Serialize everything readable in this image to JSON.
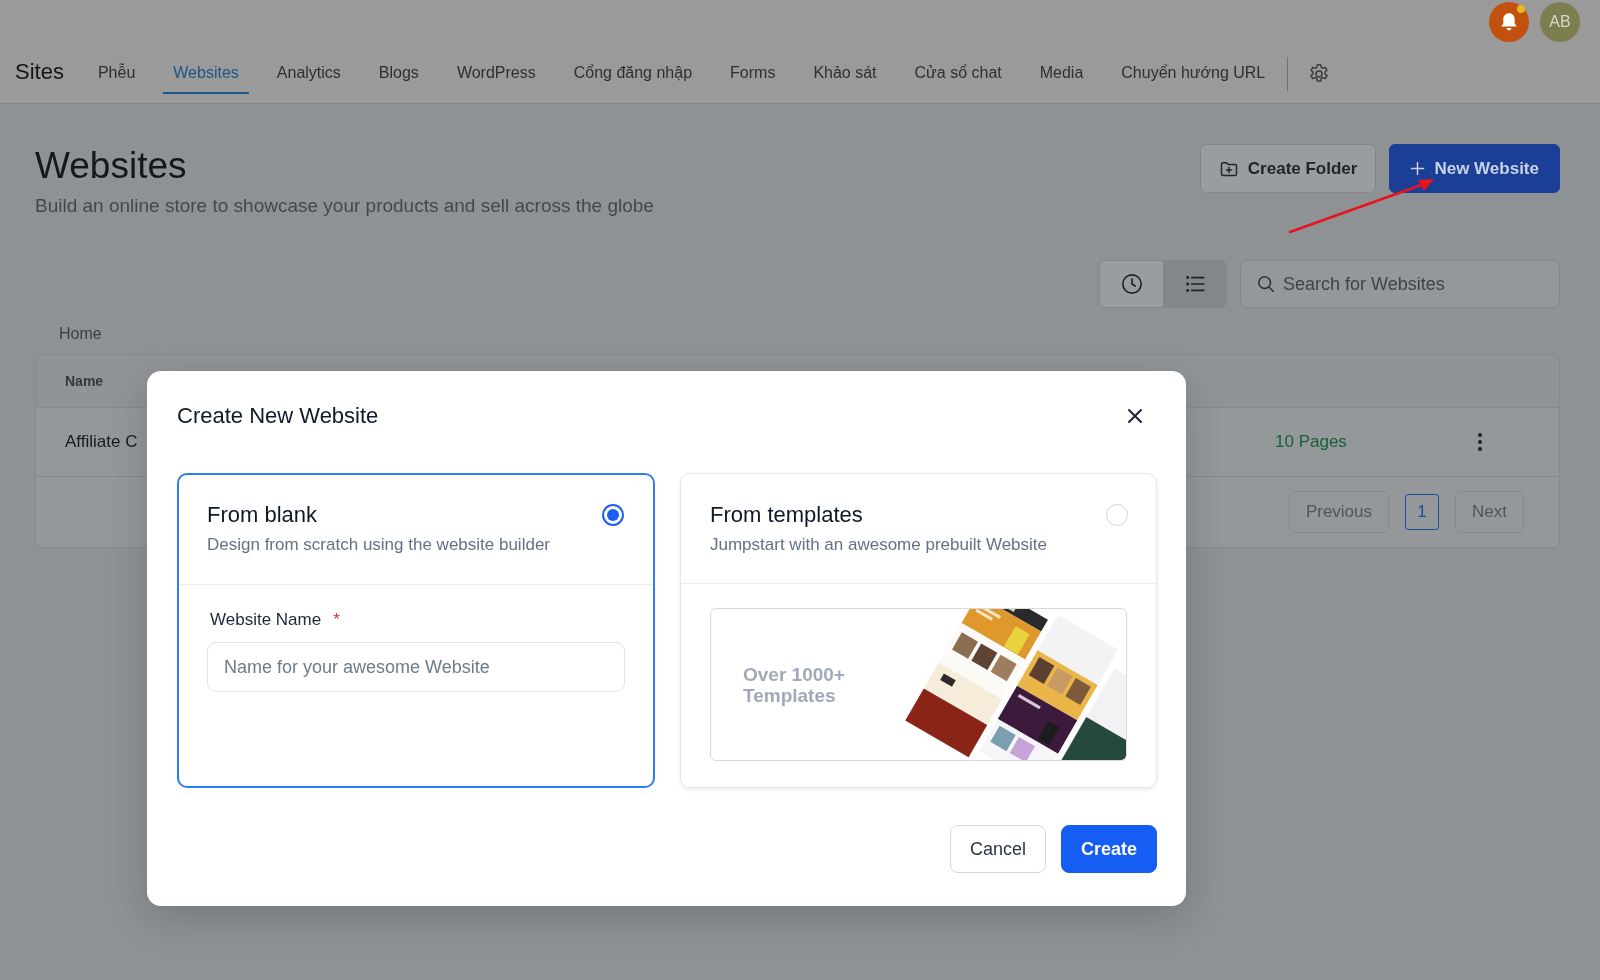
{
  "top_bar": {
    "notifications": {
      "unread": true
    },
    "avatar": {
      "initials": "AB"
    }
  },
  "nav": {
    "title": "Sites",
    "tabs": [
      {
        "label": "Phễu",
        "selected": false
      },
      {
        "label": "Websites",
        "selected": true
      },
      {
        "label": "Analytics",
        "selected": false
      },
      {
        "label": "Blogs",
        "selected": false
      },
      {
        "label": "WordPress",
        "selected": false
      },
      {
        "label": "Cổng đăng nhập",
        "selected": false
      },
      {
        "label": "Forms",
        "selected": false
      },
      {
        "label": "Khảo sát",
        "selected": false
      },
      {
        "label": "Cửa sổ chat",
        "selected": false
      },
      {
        "label": "Media",
        "selected": false
      },
      {
        "label": "Chuyển hướng URL",
        "selected": false
      }
    ]
  },
  "header": {
    "title": "Websites",
    "subtitle": "Build an online store to showcase your products and sell across the globe",
    "buttons": [
      {
        "label": "Create Folder",
        "kind": "secondary"
      },
      {
        "label": "New Website",
        "kind": "primary"
      }
    ]
  },
  "toolbar": {
    "view_toggle": [
      {
        "kind": "history",
        "selected": false
      },
      {
        "kind": "list",
        "selected": true
      }
    ],
    "search": {
      "placeholder": "Search for Websites"
    }
  },
  "breadcrumb": "Home",
  "table": {
    "columns": [
      "Name"
    ],
    "rows": [
      {
        "cells": [
          "Affiliate C",
          "10 Pages"
        ]
      }
    ]
  },
  "pagination": {
    "previous": "Previous",
    "pages": [
      {
        "label": "1",
        "selected": true
      }
    ],
    "next": "Next"
  },
  "dialog": {
    "title": "Create New Website",
    "options": [
      {
        "kind": "form",
        "title": "From blank",
        "description": "Design from scratch using the website builder",
        "selected": true,
        "field": {
          "label": "Website Name",
          "required_mark": "*",
          "placeholder": "Name for your awesome Website"
        }
      },
      {
        "kind": "preview",
        "title": "From templates",
        "description": "Jumpstart with an awesome prebuilt Website",
        "selected": false,
        "banner": "Over 1000+ Templates"
      }
    ],
    "buttons": [
      {
        "label": "Cancel",
        "kind": "secondary"
      },
      {
        "label": "Create",
        "kind": "primary"
      }
    ]
  }
}
